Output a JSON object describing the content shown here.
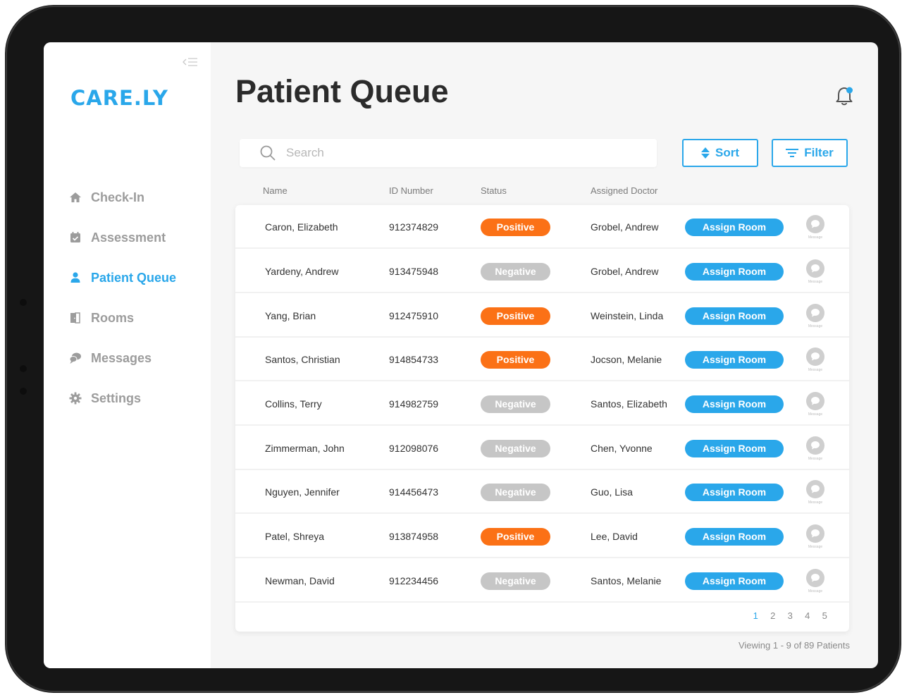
{
  "app": {
    "logo": "CARE.LY"
  },
  "sidebar": {
    "items": [
      {
        "label": "Check-In",
        "icon": "home-icon",
        "active": false
      },
      {
        "label": "Assessment",
        "icon": "calendar-check-icon",
        "active": false
      },
      {
        "label": "Patient Queue",
        "icon": "user-icon",
        "active": true
      },
      {
        "label": "Rooms",
        "icon": "door-icon",
        "active": false
      },
      {
        "label": "Messages",
        "icon": "chat-bubbles-icon",
        "active": false
      },
      {
        "label": "Settings",
        "icon": "gear-icon",
        "active": false
      }
    ]
  },
  "header": {
    "title": "Patient Queue"
  },
  "search": {
    "placeholder": "Search",
    "value": ""
  },
  "toolbar": {
    "sort_label": "Sort",
    "filter_label": "Filter"
  },
  "table": {
    "columns": [
      "Name",
      "ID Number",
      "Status",
      "Assigned Doctor"
    ],
    "assign_label": "Assign Room",
    "message_label": "Message",
    "rows": [
      {
        "name": "Caron, Elizabeth",
        "id": "912374829",
        "status": "Positive",
        "doctor": "Grobel, Andrew"
      },
      {
        "name": "Yardeny, Andrew",
        "id": "913475948",
        "status": "Negative",
        "doctor": "Grobel, Andrew"
      },
      {
        "name": "Yang, Brian",
        "id": "912475910",
        "status": "Positive",
        "doctor": "Weinstein, Linda"
      },
      {
        "name": "Santos, Christian",
        "id": "914854733",
        "status": "Positive",
        "doctor": "Jocson, Melanie"
      },
      {
        "name": "Collins, Terry",
        "id": "914982759",
        "status": "Negative",
        "doctor": "Santos, Elizabeth"
      },
      {
        "name": "Zimmerman, John",
        "id": "912098076",
        "status": "Negative",
        "doctor": "Chen, Yvonne"
      },
      {
        "name": "Nguyen, Jennifer",
        "id": "914456473",
        "status": "Negative",
        "doctor": "Guo, Lisa"
      },
      {
        "name": "Patel, Shreya",
        "id": "913874958",
        "status": "Positive",
        "doctor": "Lee, David"
      },
      {
        "name": "Newman, David",
        "id": "912234456",
        "status": "Negative",
        "doctor": "Santos, Melanie"
      }
    ]
  },
  "pagination": {
    "pages": [
      "1",
      "2",
      "3",
      "4",
      "5"
    ],
    "current": "1"
  },
  "footer": {
    "viewing": "Viewing 1 - 9 of 89 Patients"
  },
  "colors": {
    "accent": "#2aa7ea",
    "positive": "#fb7116",
    "negative": "#c6c6c6"
  }
}
